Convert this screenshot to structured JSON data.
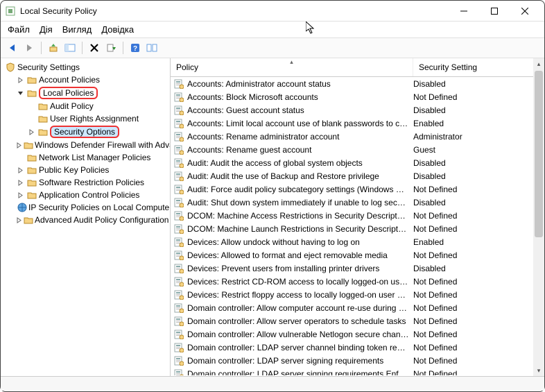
{
  "window": {
    "title": "Local Security Policy"
  },
  "menu": {
    "file": "Файл",
    "action": "Дія",
    "view": "Вигляд",
    "help": "Довідка"
  },
  "tree": {
    "root": "Security Settings",
    "account": "Account Policies",
    "local": "Local Policies",
    "audit": "Audit Policy",
    "ura": "User Rights Assignment",
    "secopt": "Security Options",
    "wdf": "Windows Defender Firewall with Adva",
    "nlmp": "Network List Manager Policies",
    "pkp": "Public Key Policies",
    "srp": "Software Restriction Policies",
    "acp": "Application Control Policies",
    "ipsec": "IP Security Policies on Local Compute",
    "aapc": "Advanced Audit Policy Configuration"
  },
  "headers": {
    "policy": "Policy",
    "setting": "Security Setting"
  },
  "policies": [
    {
      "name": "Accounts: Administrator account status",
      "setting": "Disabled"
    },
    {
      "name": "Accounts: Block Microsoft accounts",
      "setting": "Not Defined"
    },
    {
      "name": "Accounts: Guest account status",
      "setting": "Disabled"
    },
    {
      "name": "Accounts: Limit local account use of blank passwords to co...",
      "setting": "Enabled"
    },
    {
      "name": "Accounts: Rename administrator account",
      "setting": "Administrator"
    },
    {
      "name": "Accounts: Rename guest account",
      "setting": "Guest"
    },
    {
      "name": "Audit: Audit the access of global system objects",
      "setting": "Disabled"
    },
    {
      "name": "Audit: Audit the use of Backup and Restore privilege",
      "setting": "Disabled"
    },
    {
      "name": "Audit: Force audit policy subcategory settings (Windows Vis...",
      "setting": "Not Defined"
    },
    {
      "name": "Audit: Shut down system immediately if unable to log secur...",
      "setting": "Disabled"
    },
    {
      "name": "DCOM: Machine Access Restrictions in Security Descriptor D...",
      "setting": "Not Defined"
    },
    {
      "name": "DCOM: Machine Launch Restrictions in Security Descriptor ...",
      "setting": "Not Defined"
    },
    {
      "name": "Devices: Allow undock without having to log on",
      "setting": "Enabled"
    },
    {
      "name": "Devices: Allowed to format and eject removable media",
      "setting": "Not Defined"
    },
    {
      "name": "Devices: Prevent users from installing printer drivers",
      "setting": "Disabled"
    },
    {
      "name": "Devices: Restrict CD-ROM access to locally logged-on user ...",
      "setting": "Not Defined"
    },
    {
      "name": "Devices: Restrict floppy access to locally logged-on user only",
      "setting": "Not Defined"
    },
    {
      "name": "Domain controller: Allow computer account re-use during d...",
      "setting": "Not Defined"
    },
    {
      "name": "Domain controller: Allow server operators to schedule tasks",
      "setting": "Not Defined"
    },
    {
      "name": "Domain controller: Allow vulnerable Netlogon secure chann...",
      "setting": "Not Defined"
    },
    {
      "name": "Domain controller: LDAP server channel binding token requi...",
      "setting": "Not Defined"
    },
    {
      "name": "Domain controller: LDAP server signing requirements",
      "setting": "Not Defined"
    },
    {
      "name": "Domain controller: LDAP server signing requirements Enforc",
      "setting": "Not Defined"
    }
  ]
}
